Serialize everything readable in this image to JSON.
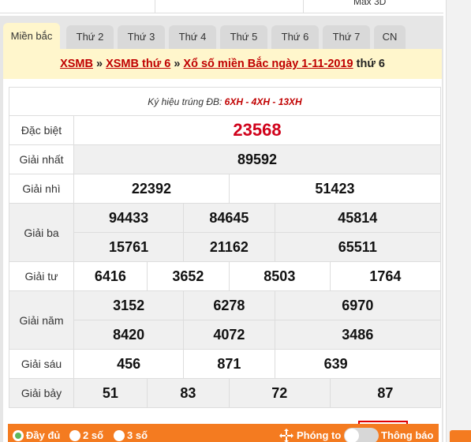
{
  "top_strip": {
    "max3d_label": "Max 3D"
  },
  "tabs": [
    {
      "label": "Miền bắc",
      "active": true
    },
    {
      "label": "Thứ 2"
    },
    {
      "label": "Thứ 3"
    },
    {
      "label": "Thứ 4"
    },
    {
      "label": "Thứ 5"
    },
    {
      "label": "Thứ 6"
    },
    {
      "label": "Thứ 7"
    },
    {
      "label": "CN"
    }
  ],
  "title": {
    "link1": "XSMB",
    "sep1": " » ",
    "link2": "XSMB thứ 6",
    "sep2": " » ",
    "link3": "Xổ số miền Bắc ngày 1-11-2019",
    "suffix": " thứ 6"
  },
  "results": {
    "symbol_label": "Ký hiệu trúng ĐB: ",
    "symbol_value": "6XH - 4XH - 13XH",
    "special": {
      "label": "Đặc biệt",
      "numbers": [
        "23568"
      ]
    },
    "first": {
      "label": "Giải nhất",
      "numbers": [
        "89592"
      ]
    },
    "second": {
      "label": "Giải nhì",
      "numbers": [
        "22392",
        "51423"
      ]
    },
    "third": {
      "label": "Giải ba",
      "numbers": [
        "94433",
        "84645",
        "45814",
        "15761",
        "21162",
        "65511"
      ]
    },
    "fourth": {
      "label": "Giải tư",
      "numbers": [
        "6416",
        "3652",
        "8503",
        "1764"
      ]
    },
    "fifth": {
      "label": "Giải năm",
      "numbers": [
        "3152",
        "6278",
        "6970",
        "8420",
        "4072",
        "3486"
      ]
    },
    "sixth": {
      "label": "Giải sáu",
      "numbers": [
        "456",
        "871",
        "639"
      ]
    },
    "seventh": {
      "label": "Giải bảy",
      "numbers": [
        "51",
        "83",
        "72",
        "87"
      ]
    }
  },
  "bottom_bar": {
    "full_label": "Đầy đủ",
    "two_label": "2 số",
    "three_label": "3 số",
    "zoom_label": "Phóng to",
    "notify_label": "Thông báo"
  },
  "colors": {
    "accent": "#f47b20",
    "red": "#c00000",
    "tab_active": "#fff6cc"
  }
}
